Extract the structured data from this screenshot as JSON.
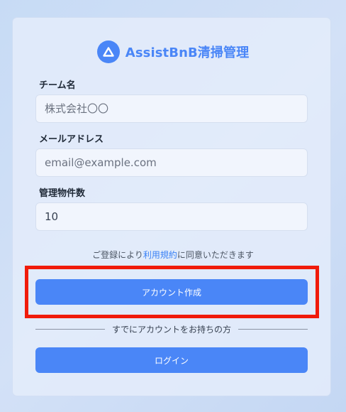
{
  "brand": {
    "title": "AssistBnB清掃管理",
    "logo_icon": "triangle-logo-icon",
    "accent_color": "#4a86f7"
  },
  "form": {
    "team_name": {
      "label": "チーム名",
      "placeholder": "株式会社〇〇",
      "value": ""
    },
    "email": {
      "label": "メールアドレス",
      "placeholder": "email@example.com",
      "value": ""
    },
    "property_count": {
      "label": "管理物件数",
      "placeholder": "",
      "value": "10"
    }
  },
  "terms": {
    "prefix": "ご登録により",
    "link": "利用規約",
    "suffix": "に同意いただきます"
  },
  "buttons": {
    "create_account": "アカウント作成",
    "login": "ログイン"
  },
  "divider": {
    "text": "すでにアカウントをお持ちの方"
  },
  "highlight_color": "#f01b0a"
}
